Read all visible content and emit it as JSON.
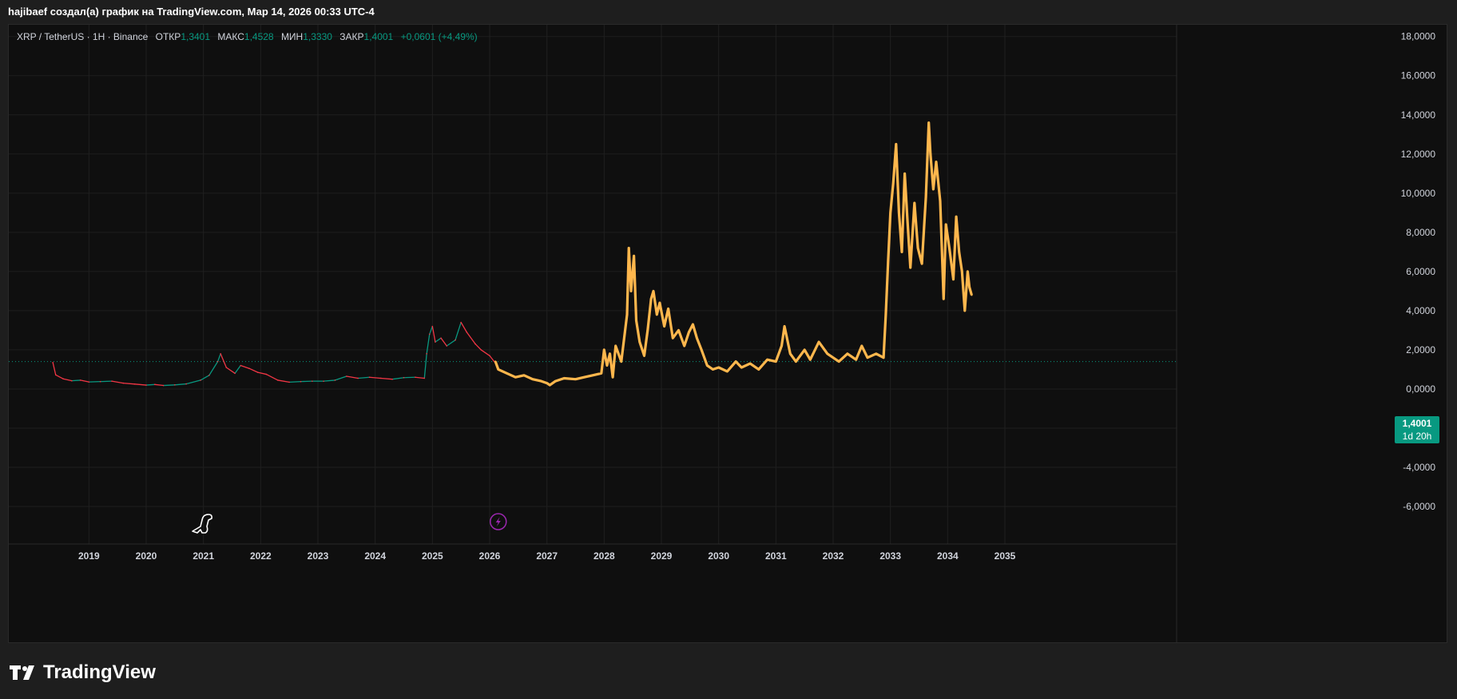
{
  "header": {
    "caption": "hajibaef создал(а) график на TradingView.com, Мар 14, 2026 00:33 UTC-4"
  },
  "legend": {
    "symbol": "XRP / TetherUS · 1H · Binance",
    "open_label": "ОТКР",
    "open_value": "1,3401",
    "high_label": "МАКС",
    "high_value": "1,4528",
    "low_label": "МИН",
    "low_value": "1,3330",
    "close_label": "ЗАКР",
    "close_value": "1,4001",
    "change": "+0,0601 (+4,49%)"
  },
  "price_badge": {
    "price": "1,4001",
    "countdown": "1d 20h"
  },
  "brand": {
    "name": "TradingView"
  },
  "colors": {
    "background": "#0f0f0f",
    "up": "#089981",
    "down": "#f23645",
    "projection": "#ffb74d",
    "grid": "#1f1f1f",
    "axis_text": "#d1d4dc"
  },
  "chart_data": {
    "type": "line",
    "y_ticks": [
      "18,0000",
      "16,0000",
      "14,0000",
      "12,0000",
      "10,0000",
      "8,0000",
      "6,0000",
      "4,0000",
      "2,0000",
      "0,0000",
      "-2,0000",
      "-4,0000",
      "-6,0000"
    ],
    "ylim": [
      -7.1,
      18.6
    ],
    "x_ticks": [
      "2019",
      "2020",
      "2021",
      "2022",
      "2023",
      "2024",
      "2025",
      "2026",
      "2027",
      "2028",
      "2029",
      "2030",
      "2031",
      "2032",
      "2033",
      "2034",
      "2035"
    ],
    "xlim": [
      2017.6,
      2038.0
    ],
    "current_price": 1.4001,
    "series": [
      {
        "kind": "history",
        "points": [
          [
            2018.37,
            1.35
          ],
          [
            2018.42,
            0.72
          ],
          [
            2018.55,
            0.52
          ],
          [
            2018.7,
            0.42
          ],
          [
            2018.85,
            0.45
          ],
          [
            2019.0,
            0.36
          ],
          [
            2019.2,
            0.38
          ],
          [
            2019.4,
            0.4
          ],
          [
            2019.6,
            0.3
          ],
          [
            2019.8,
            0.25
          ],
          [
            2020.0,
            0.2
          ],
          [
            2020.15,
            0.23
          ],
          [
            2020.3,
            0.18
          ],
          [
            2020.5,
            0.21
          ],
          [
            2020.7,
            0.26
          ],
          [
            2020.95,
            0.45
          ],
          [
            2021.1,
            0.7
          ],
          [
            2021.25,
            1.4
          ],
          [
            2021.3,
            1.8
          ],
          [
            2021.4,
            1.1
          ],
          [
            2021.55,
            0.8
          ],
          [
            2021.65,
            1.2
          ],
          [
            2021.8,
            1.05
          ],
          [
            2021.95,
            0.85
          ],
          [
            2022.1,
            0.75
          ],
          [
            2022.3,
            0.45
          ],
          [
            2022.5,
            0.35
          ],
          [
            2022.7,
            0.38
          ],
          [
            2022.9,
            0.4
          ],
          [
            2023.1,
            0.4
          ],
          [
            2023.3,
            0.45
          ],
          [
            2023.5,
            0.65
          ],
          [
            2023.7,
            0.55
          ],
          [
            2023.9,
            0.6
          ],
          [
            2024.1,
            0.55
          ],
          [
            2024.3,
            0.5
          ],
          [
            2024.5,
            0.58
          ],
          [
            2024.7,
            0.6
          ],
          [
            2024.86,
            0.55
          ],
          [
            2024.9,
            1.8
          ],
          [
            2024.95,
            2.8
          ],
          [
            2025.0,
            3.2
          ],
          [
            2025.05,
            2.4
          ],
          [
            2025.15,
            2.6
          ],
          [
            2025.25,
            2.2
          ],
          [
            2025.4,
            2.5
          ],
          [
            2025.5,
            3.4
          ],
          [
            2025.6,
            2.9
          ],
          [
            2025.75,
            2.3
          ],
          [
            2025.85,
            2.0
          ],
          [
            2026.0,
            1.7
          ],
          [
            2026.08,
            1.4
          ]
        ]
      },
      {
        "kind": "projection",
        "points": [
          [
            2026.1,
            1.4
          ],
          [
            2026.15,
            1.0
          ],
          [
            2026.3,
            0.8
          ],
          [
            2026.45,
            0.6
          ],
          [
            2026.6,
            0.7
          ],
          [
            2026.75,
            0.5
          ],
          [
            2026.9,
            0.4
          ],
          [
            2027.0,
            0.3
          ],
          [
            2027.05,
            0.2
          ],
          [
            2027.15,
            0.4
          ],
          [
            2027.3,
            0.55
          ],
          [
            2027.5,
            0.5
          ],
          [
            2027.65,
            0.6
          ],
          [
            2027.8,
            0.7
          ],
          [
            2027.95,
            0.8
          ],
          [
            2028.0,
            2.0
          ],
          [
            2028.05,
            1.2
          ],
          [
            2028.1,
            1.8
          ],
          [
            2028.15,
            0.6
          ],
          [
            2028.2,
            2.2
          ],
          [
            2028.3,
            1.4
          ],
          [
            2028.35,
            2.6
          ],
          [
            2028.4,
            3.8
          ],
          [
            2028.43,
            7.2
          ],
          [
            2028.47,
            5.0
          ],
          [
            2028.52,
            6.8
          ],
          [
            2028.56,
            3.5
          ],
          [
            2028.62,
            2.4
          ],
          [
            2028.7,
            1.7
          ],
          [
            2028.76,
            3.0
          ],
          [
            2028.82,
            4.6
          ],
          [
            2028.86,
            5.0
          ],
          [
            2028.92,
            3.8
          ],
          [
            2028.97,
            4.4
          ],
          [
            2029.05,
            3.2
          ],
          [
            2029.12,
            4.1
          ],
          [
            2029.2,
            2.6
          ],
          [
            2029.3,
            3.0
          ],
          [
            2029.4,
            2.2
          ],
          [
            2029.48,
            2.9
          ],
          [
            2029.55,
            3.3
          ],
          [
            2029.62,
            2.6
          ],
          [
            2029.7,
            2.0
          ],
          [
            2029.8,
            1.2
          ],
          [
            2029.9,
            1.0
          ],
          [
            2030.0,
            1.1
          ],
          [
            2030.15,
            0.9
          ],
          [
            2030.3,
            1.4
          ],
          [
            2030.4,
            1.1
          ],
          [
            2030.55,
            1.3
          ],
          [
            2030.7,
            1.0
          ],
          [
            2030.85,
            1.5
          ],
          [
            2031.0,
            1.4
          ],
          [
            2031.1,
            2.2
          ],
          [
            2031.15,
            3.2
          ],
          [
            2031.25,
            1.8
          ],
          [
            2031.35,
            1.4
          ],
          [
            2031.5,
            2.0
          ],
          [
            2031.6,
            1.5
          ],
          [
            2031.75,
            2.4
          ],
          [
            2031.9,
            1.8
          ],
          [
            2032.0,
            1.6
          ],
          [
            2032.1,
            1.4
          ],
          [
            2032.25,
            1.8
          ],
          [
            2032.4,
            1.5
          ],
          [
            2032.5,
            2.2
          ],
          [
            2032.6,
            1.6
          ],
          [
            2032.75,
            1.8
          ],
          [
            2032.88,
            1.6
          ],
          [
            2032.92,
            3.8
          ],
          [
            2032.96,
            6.5
          ],
          [
            2033.0,
            9.0
          ],
          [
            2033.05,
            10.5
          ],
          [
            2033.1,
            12.5
          ],
          [
            2033.15,
            9.0
          ],
          [
            2033.2,
            7.0
          ],
          [
            2033.25,
            11.0
          ],
          [
            2033.3,
            8.5
          ],
          [
            2033.35,
            6.2
          ],
          [
            2033.42,
            9.5
          ],
          [
            2033.48,
            7.2
          ],
          [
            2033.55,
            6.4
          ],
          [
            2033.62,
            9.8
          ],
          [
            2033.67,
            13.6
          ],
          [
            2033.7,
            12.0
          ],
          [
            2033.75,
            10.2
          ],
          [
            2033.8,
            11.6
          ],
          [
            2033.87,
            9.6
          ],
          [
            2033.93,
            4.6
          ],
          [
            2033.97,
            8.4
          ],
          [
            2034.03,
            7.2
          ],
          [
            2034.1,
            5.6
          ],
          [
            2034.15,
            8.8
          ],
          [
            2034.2,
            7.0
          ],
          [
            2034.25,
            6.0
          ],
          [
            2034.3,
            4.0
          ],
          [
            2034.35,
            6.0
          ],
          [
            2034.38,
            5.2
          ],
          [
            2034.42,
            4.8
          ]
        ]
      }
    ]
  }
}
